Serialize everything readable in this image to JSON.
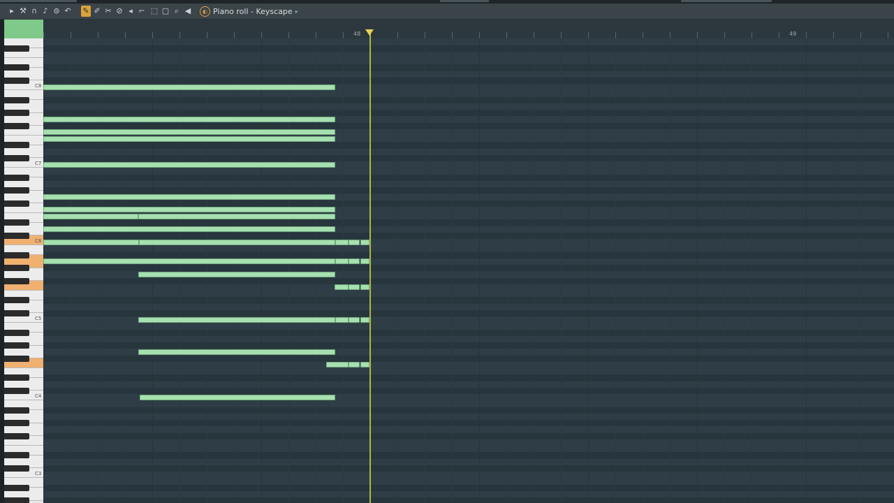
{
  "window": {
    "title": "Piano roll - Keyscape"
  },
  "toolbar": {
    "icons": [
      "play-arrow-icon",
      "wrench-icon",
      "magnet-icon",
      "note-icon",
      "stamp-icon",
      "undo-icon",
      "pencil-icon",
      "paint-icon",
      "delete-icon",
      "mute-icon",
      "slip-icon",
      "slice-icon",
      "select-icon",
      "zoom-icon",
      "playback-icon"
    ]
  },
  "ruler": {
    "bar_labels": [
      "48",
      "49"
    ]
  },
  "keyboard": {
    "octave_labels": [
      "C8",
      "C7",
      "C6",
      "C5",
      "C4",
      "C3"
    ]
  },
  "colors": {
    "note_fill": "#a7e0b0",
    "note_border": "#72a97d",
    "highlight_key": "#f0b070",
    "playhead": "#e6d250"
  },
  "notes": [
    {
      "pitch": 96,
      "start": 0,
      "len": 418
    },
    {
      "pitch": 91,
      "start": 0,
      "len": 418
    },
    {
      "pitch": 89,
      "start": 0,
      "len": 418
    },
    {
      "pitch": 88,
      "start": 0,
      "len": 418
    },
    {
      "pitch": 84,
      "start": 0,
      "len": 418
    },
    {
      "pitch": 79,
      "start": 0,
      "len": 418
    },
    {
      "pitch": 77,
      "start": 0,
      "len": 418
    },
    {
      "pitch": 76,
      "start": 0,
      "len": 136
    },
    {
      "pitch": 76,
      "start": 136,
      "len": 282
    },
    {
      "pitch": 74,
      "start": 0,
      "len": 418
    },
    {
      "pitch": 72,
      "start": 0,
      "len": 137
    },
    {
      "pitch": 72,
      "start": 137,
      "len": 281
    },
    {
      "pitch": 72,
      "start": 418,
      "len": 19
    },
    {
      "pitch": 72,
      "start": 437,
      "len": 16
    },
    {
      "pitch": 72,
      "start": 454,
      "len": 13
    },
    {
      "pitch": 69,
      "start": 0,
      "len": 418
    },
    {
      "pitch": 69,
      "start": 418,
      "len": 19
    },
    {
      "pitch": 69,
      "start": 437,
      "len": 16
    },
    {
      "pitch": 69,
      "start": 454,
      "len": 13
    },
    {
      "pitch": 67,
      "start": 136,
      "len": 282
    },
    {
      "pitch": 65,
      "start": 417,
      "len": 20
    },
    {
      "pitch": 65,
      "start": 437,
      "len": 16
    },
    {
      "pitch": 65,
      "start": 454,
      "len": 13
    },
    {
      "pitch": 60,
      "start": 136,
      "len": 282
    },
    {
      "pitch": 60,
      "start": 418,
      "len": 19
    },
    {
      "pitch": 60,
      "start": 437,
      "len": 16
    },
    {
      "pitch": 60,
      "start": 454,
      "len": 13
    },
    {
      "pitch": 55,
      "start": 136,
      "len": 282
    },
    {
      "pitch": 53,
      "start": 405,
      "len": 32
    },
    {
      "pitch": 53,
      "start": 437,
      "len": 16
    },
    {
      "pitch": 53,
      "start": 454,
      "len": 13
    },
    {
      "pitch": 48,
      "start": 138,
      "len": 280
    }
  ]
}
